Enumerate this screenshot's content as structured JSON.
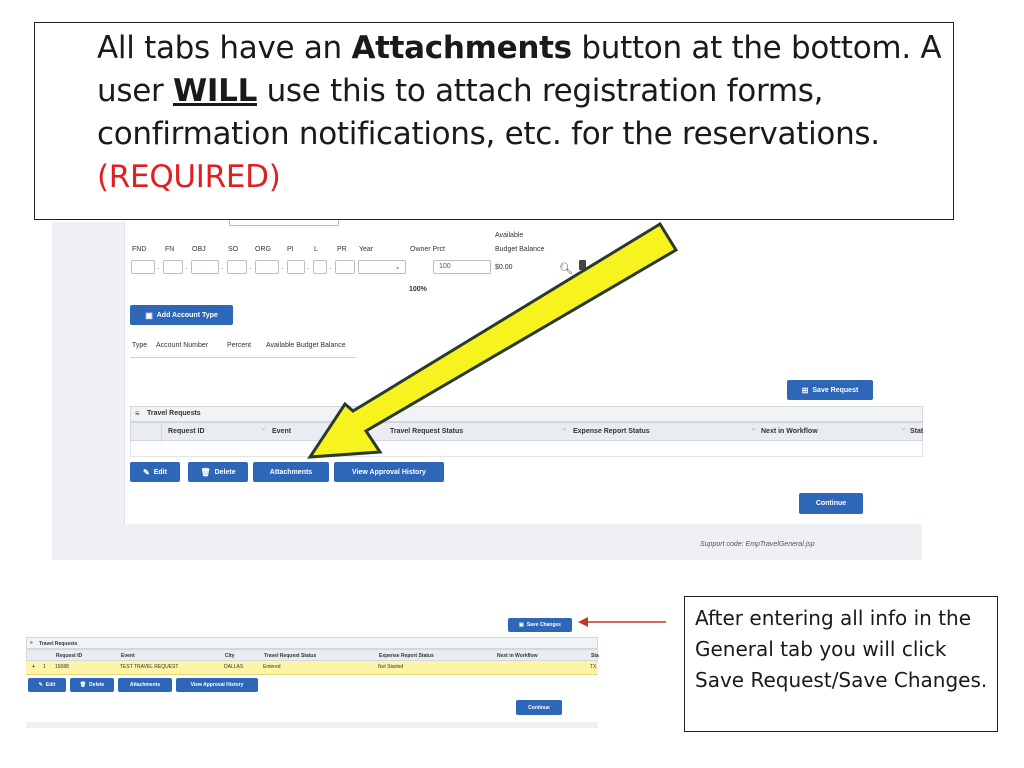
{
  "note": {
    "part1": "All tabs have an ",
    "attachments_word": "Attachments",
    "part2": " button at the bottom. A user ",
    "will_word": "WILL",
    "part3": " use this to attach registration forms, confirmation notifications, etc. for the reservations.",
    "required": "(REQUIRED)"
  },
  "account_form": {
    "headers": [
      "FND",
      "FN",
      "OBJ",
      "SO",
      "ORG",
      "PI",
      "L",
      "PR",
      "Year",
      "Owner Prct"
    ],
    "available_label": "Available",
    "budget_balance_label": "Budget Balance",
    "owner_prct_value": "100",
    "budget_value": "$0.00",
    "total_percent": "100%"
  },
  "add_account_type_button": "Add Account Type",
  "account_table_headers": [
    "Type",
    "Account Number",
    "Percent",
    "Available Budget Balance"
  ],
  "save_request_button": "Save Request",
  "travel_requests": {
    "title": "Travel Requests",
    "columns": [
      "Request ID",
      "Event",
      "Travel Request Status",
      "Expense Report Status",
      "Next in Workflow",
      "Stat"
    ]
  },
  "actions": {
    "edit": "Edit",
    "delete": "Delete",
    "attachments": "Attachments",
    "view_approval_history": "View Approval History",
    "continue": "Continue"
  },
  "support_code": "Support code: EmpTravelGeneral.jsp",
  "bottom": {
    "save_changes_button": "Save Changes",
    "title": "Travel Requests",
    "columns": [
      "Request ID",
      "Event",
      "City",
      "Travel Request Status",
      "Expense Report Status",
      "Next in Workflow",
      "Sta"
    ],
    "row": {
      "marker": "+",
      "index": "1",
      "request_id": "15088",
      "event": "TEST TRAVEL REQUEST",
      "city": "DALLAS",
      "travel_request_status": "Entered",
      "expense_report_status": "Not Started",
      "next_in_workflow": "",
      "status": "TX"
    },
    "edit": "Edit",
    "delete": "Delete",
    "attachments": "Attachments",
    "view_approval_history": "View Approval History",
    "continue": "Continue"
  },
  "callout": "After entering all info in the General tab you will click Save Request/Save Changes.",
  "colors": {
    "primary_button": "#2f67b8",
    "arrow_fill": "#f7f31e",
    "required_text": "#e02020",
    "highlight_row": "#fdf4a8"
  }
}
